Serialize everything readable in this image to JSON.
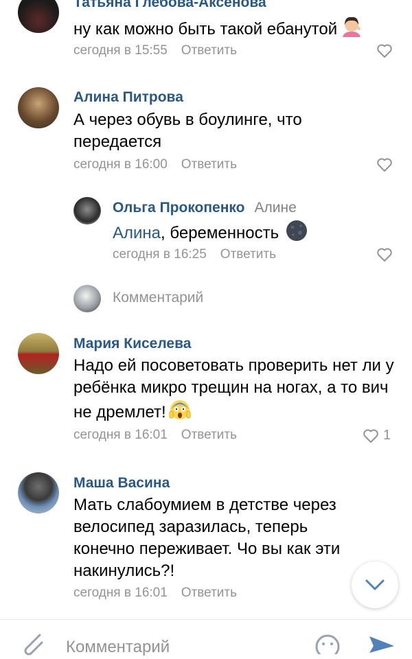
{
  "comments": [
    {
      "author": "Татьяна Глебова-Аксенова",
      "text": "ну как можно быть такой ебанутой",
      "time": "сегодня в 15:55",
      "reply_label": "Ответить",
      "likes": ""
    },
    {
      "author": "Алина Питрова",
      "text": "А через обувь в боулинге, что передается",
      "time": "сегодня в 16:00",
      "reply_label": "Ответить",
      "likes": ""
    },
    {
      "author": "Ольга Прокопенко",
      "addressee": "Алине",
      "reply_to": "Алина",
      "text": ", беременность",
      "time": "сегодня в 16:25",
      "reply_label": "Ответить",
      "likes": ""
    },
    {
      "author": "Мария Киселева",
      "text": "Надо ей посоветовать проверить нет ли у ребёнка микро трещин на ногах, а то вич не дремлет!",
      "time": "сегодня в 16:01",
      "reply_label": "Ответить",
      "likes": "1"
    },
    {
      "author": "Маша Васина",
      "text": "Мать слабоумием в детстве через велосипед заразилась, теперь конечно переживает. Чо вы как эти накинулись?!",
      "time": "сегодня в 16:01",
      "reply_label": "Ответить",
      "likes": ""
    }
  ],
  "thread_reply": {
    "placeholder": "Комментарий"
  },
  "composer": {
    "placeholder": "Комментарий"
  },
  "icons": {
    "like": "heart-outline-icon",
    "scroll": "chevron-down-icon",
    "attach": "paperclip-icon",
    "emoji": "smiley-icon",
    "send": "send-arrow-icon"
  },
  "colors": {
    "link": "#2a5885",
    "meta": "#939393",
    "send": "#5181b8"
  }
}
